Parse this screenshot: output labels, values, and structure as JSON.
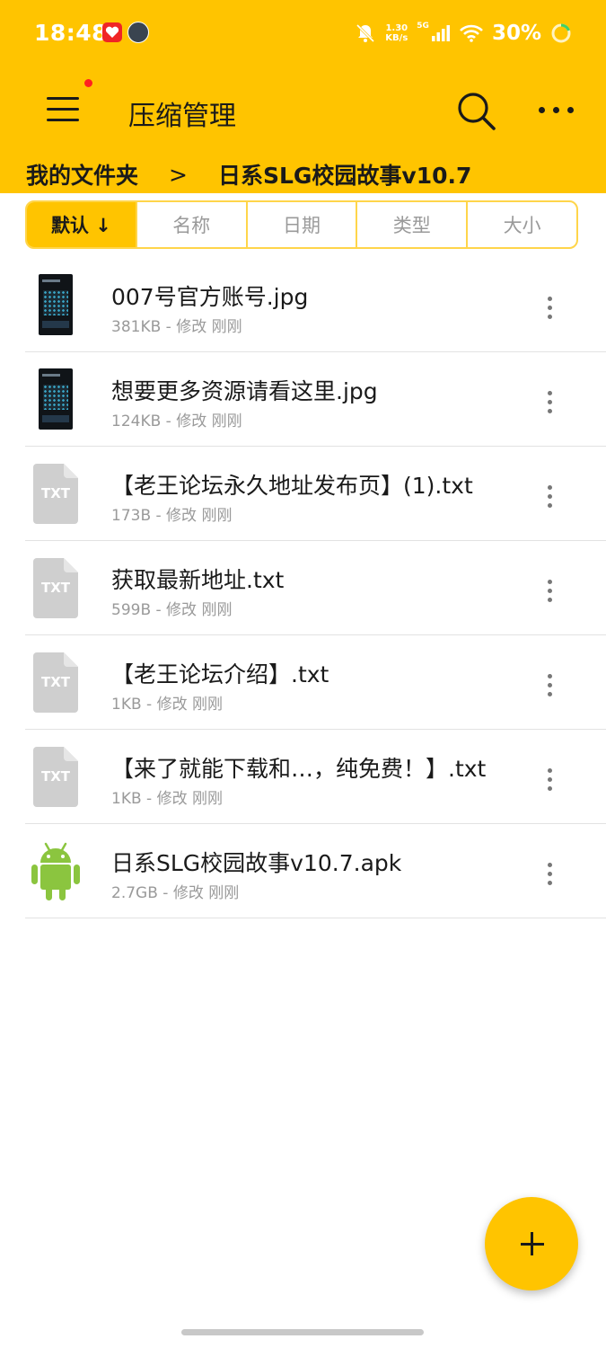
{
  "status_bar": {
    "time": "18:48",
    "net_speed_value": "1.30",
    "net_speed_unit": "KB/s",
    "network": "5G",
    "battery": "30%"
  },
  "app_bar": {
    "title": "压缩管理"
  },
  "breadcrumb": {
    "root": "我的文件夹",
    "separator": ">",
    "current": "日系SLG校园故事v10.7"
  },
  "sort_tabs": [
    {
      "label": "默认 ↓",
      "active": true
    },
    {
      "label": "名称",
      "active": false
    },
    {
      "label": "日期",
      "active": false
    },
    {
      "label": "类型",
      "active": false
    },
    {
      "label": "大小",
      "active": false
    }
  ],
  "files": [
    {
      "name": "007号官方账号.jpg",
      "meta": "381KB - 修改 刚刚",
      "type": "image"
    },
    {
      "name": "想要更多资源请看这里.jpg",
      "meta": "124KB - 修改 刚刚",
      "type": "image"
    },
    {
      "name": "【老王论坛永久地址发布页】(1).txt",
      "meta": "173B - 修改 刚刚",
      "type": "txt",
      "icon_label": "TXT"
    },
    {
      "name": "获取最新地址.txt",
      "meta": "599B - 修改 刚刚",
      "type": "txt",
      "icon_label": "TXT"
    },
    {
      "name": "【老王论坛介绍】.txt",
      "meta": "1KB - 修改 刚刚",
      "type": "txt",
      "icon_label": "TXT"
    },
    {
      "name": "【来了就能下载和…，纯免费！】.txt",
      "meta": "1KB - 修改 刚刚",
      "type": "txt",
      "icon_label": "TXT"
    },
    {
      "name": "日系SLG校园故事v10.7.apk",
      "meta": "2.7GB - 修改 刚刚",
      "type": "apk"
    }
  ],
  "colors": {
    "accent": "#FFC400",
    "apk_green": "#8BC53F",
    "txt_gray": "#CFCFCF"
  }
}
